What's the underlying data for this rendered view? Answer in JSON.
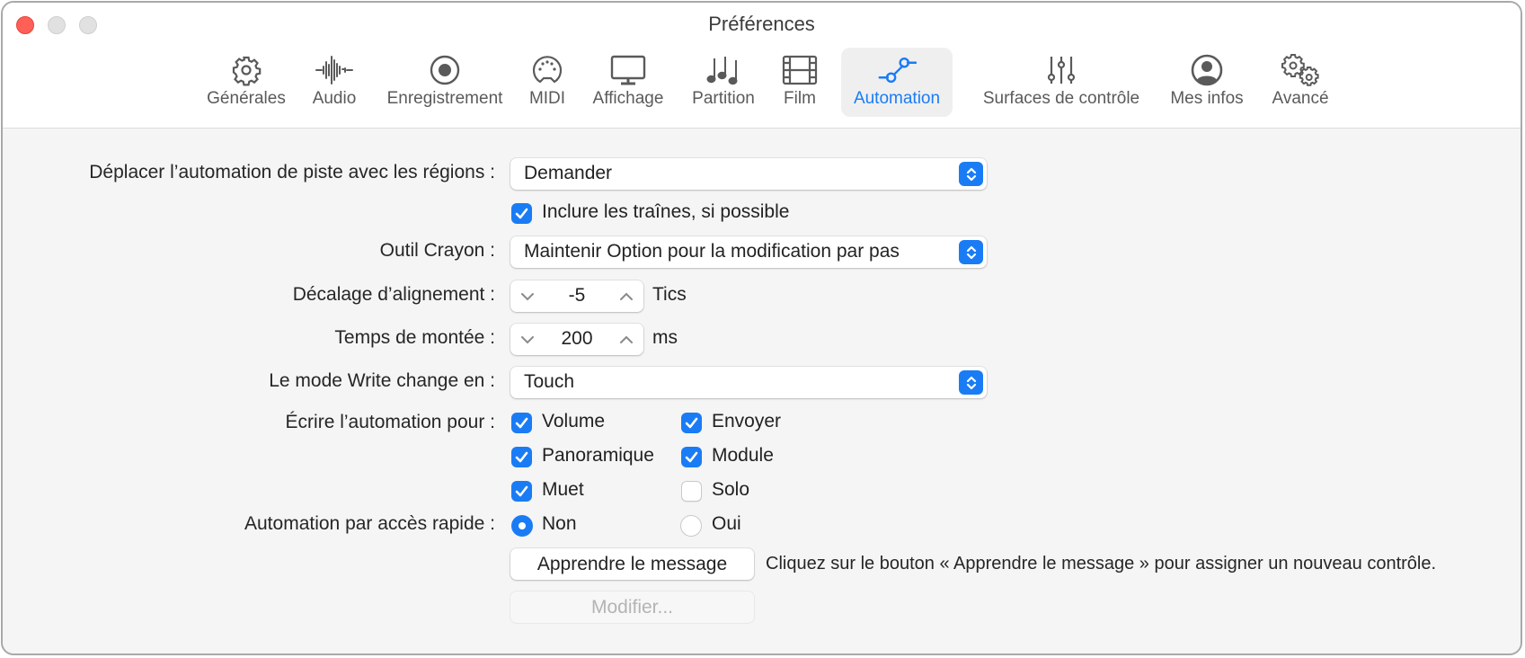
{
  "window": {
    "title": "Préférences",
    "controls": [
      "close",
      "minimize",
      "zoom"
    ]
  },
  "toolbar": {
    "items": [
      {
        "label": "Générales",
        "icon": "gear-icon",
        "active": false
      },
      {
        "label": "Audio",
        "icon": "waveform-icon",
        "active": false
      },
      {
        "label": "Enregistrement",
        "icon": "record-icon",
        "active": false
      },
      {
        "label": "MIDI",
        "icon": "midi-connector-icon",
        "active": false
      },
      {
        "label": "Affichage",
        "icon": "display-icon",
        "active": false
      },
      {
        "label": "Partition",
        "icon": "music-notes-icon",
        "active": false
      },
      {
        "label": "Film",
        "icon": "film-icon",
        "active": false
      },
      {
        "label": "Automation",
        "icon": "automation-icon",
        "active": true
      },
      {
        "label": "Surfaces de contrôle",
        "icon": "sliders-icon",
        "active": false
      },
      {
        "label": "Mes infos",
        "icon": "person-icon",
        "active": false
      },
      {
        "label": "Avancé",
        "icon": "gears-icon",
        "active": false
      }
    ]
  },
  "accent_color": "#1a7cf5",
  "form": {
    "move_automation": {
      "label": "Déplacer l’automation de piste avec les régions :",
      "value": "Demander"
    },
    "include_tails": {
      "label": "Inclure les traînes, si possible",
      "checked": true
    },
    "pencil_tool": {
      "label": "Outil Crayon :",
      "value": "Maintenir Option pour la modification par pas"
    },
    "snap_offset": {
      "label": "Décalage d’alignement :",
      "value": "-5",
      "unit": "Tics"
    },
    "ramp_time": {
      "label": "Temps de montée :",
      "value": "200",
      "unit": "ms"
    },
    "write_mode": {
      "label": "Le mode Write change en :",
      "value": "Touch"
    },
    "write_automation": {
      "label": "Écrire l’automation pour :",
      "options": [
        {
          "label": "Volume",
          "checked": true
        },
        {
          "label": "Envoyer",
          "checked": true
        },
        {
          "label": "Panoramique",
          "checked": true
        },
        {
          "label": "Module",
          "checked": true
        },
        {
          "label": "Muet",
          "checked": true
        },
        {
          "label": "Solo",
          "checked": false
        }
      ]
    },
    "quick_access": {
      "label": "Automation par accès rapide :",
      "options": [
        {
          "label": "Non",
          "selected": true
        },
        {
          "label": "Oui",
          "selected": false
        }
      ]
    },
    "learn_button": "Apprendre le message",
    "learn_hint": "Cliquez sur le bouton « Apprendre le message » pour assigner un nouveau contrôle.",
    "edit_button": "Modifier..."
  }
}
